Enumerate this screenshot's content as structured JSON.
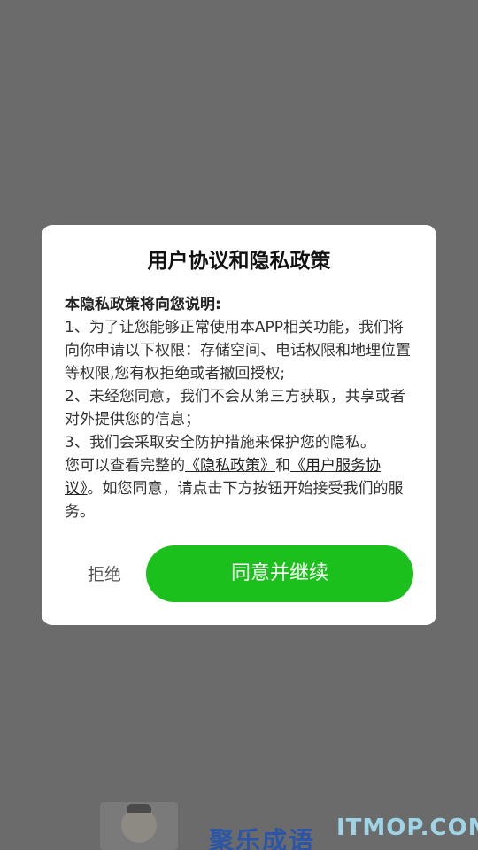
{
  "dialog": {
    "title": "用户协议和隐私政策",
    "heading": "本隐私政策将向您说明:",
    "item1": "1、为了让您能够正常使用本APP相关功能，我们将向你申请以下权限：存储空间、电话权限和地理位置等权限,您有权拒绝或者撤回授权;",
    "item2": "2、未经您同意，我们不会从第三方获取，共享或者对外提供您的信息；",
    "item3": "3、我们会采取安全防护措施来保护您的隐私。",
    "view_prefix": "您可以查看完整的",
    "privacy_link": "《隐私政策》",
    "and_text": "和",
    "agreement_link": "《用户服务协议》",
    "view_suffix": "。如您同意，请点击下方按钮开始接受我们的服务。",
    "reject_label": "拒绝",
    "agree_label": "同意并继续"
  },
  "background": {
    "app_name": "聚乐成语",
    "watermark": "ITMOP.COM"
  },
  "colors": {
    "overlay": "#6b6b6b",
    "agree_button": "#1cc01c",
    "dialog_bg": "#ffffff"
  }
}
